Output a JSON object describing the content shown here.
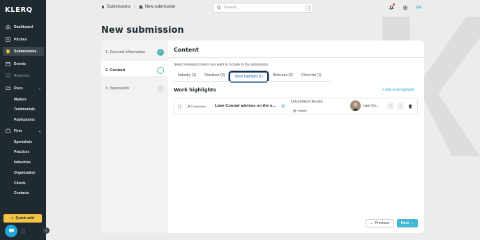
{
  "app": {
    "logo": "KLERQ"
  },
  "sidebar": {
    "items": [
      {
        "label": "Dashboard",
        "icon": "home-icon"
      },
      {
        "label": "Pitches",
        "icon": "pitches-icon"
      },
      {
        "label": "Submissions",
        "icon": "submissions-icon",
        "active": true
      },
      {
        "label": "Events",
        "icon": "calendar-icon"
      },
      {
        "label": "Referrals",
        "icon": "referrals-icon",
        "disabled": true
      },
      {
        "label": "Docs",
        "icon": "folder-icon"
      },
      {
        "label": "Firm",
        "icon": "building-icon"
      }
    ],
    "docs_children": [
      "Matters",
      "Testimonials",
      "Publications"
    ],
    "firm_children": [
      "Specialists",
      "Practices",
      "Industries",
      "Organization",
      "Clients",
      "Contacts"
    ],
    "quick_add": "Quick add"
  },
  "header": {
    "breadcrumb": [
      "Submissions",
      "New submission"
    ],
    "search_placeholder": "Search...",
    "search_shortcut": "/",
    "user_initials": "ES"
  },
  "page": {
    "title": "New submission"
  },
  "steps": [
    {
      "number": "1.",
      "label": "General information",
      "state": "done"
    },
    {
      "number": "2.",
      "label": "Content",
      "state": "current"
    },
    {
      "number": "3.",
      "label": "Specialists",
      "state": "pending"
    }
  ],
  "content": {
    "title": "Content",
    "instructions": "Select relevant content you want to include in the submission.",
    "tabs": [
      {
        "label": "Industry (1)"
      },
      {
        "label": "Practices (0)"
      },
      {
        "label": "Work highlight (1)",
        "active": true
      },
      {
        "label": "Referees (2)"
      },
      {
        "label": "Client list (1)"
      }
    ],
    "section_title": "Work highlights",
    "add_label": "Add work highlight",
    "rows": [
      {
        "status": "Publishable",
        "title": "Liam Conrad advises on the o...",
        "client": "UrbanNest Realty",
        "visibility": "Hidden",
        "person": "Liam Co..."
      }
    ],
    "previous_label": "Previous",
    "next_label": "Next"
  },
  "colors": {
    "accent": "#43b7d8",
    "sidebar": "#1f2a30",
    "highlight": "#f4c545",
    "success": "#56b3b3"
  }
}
